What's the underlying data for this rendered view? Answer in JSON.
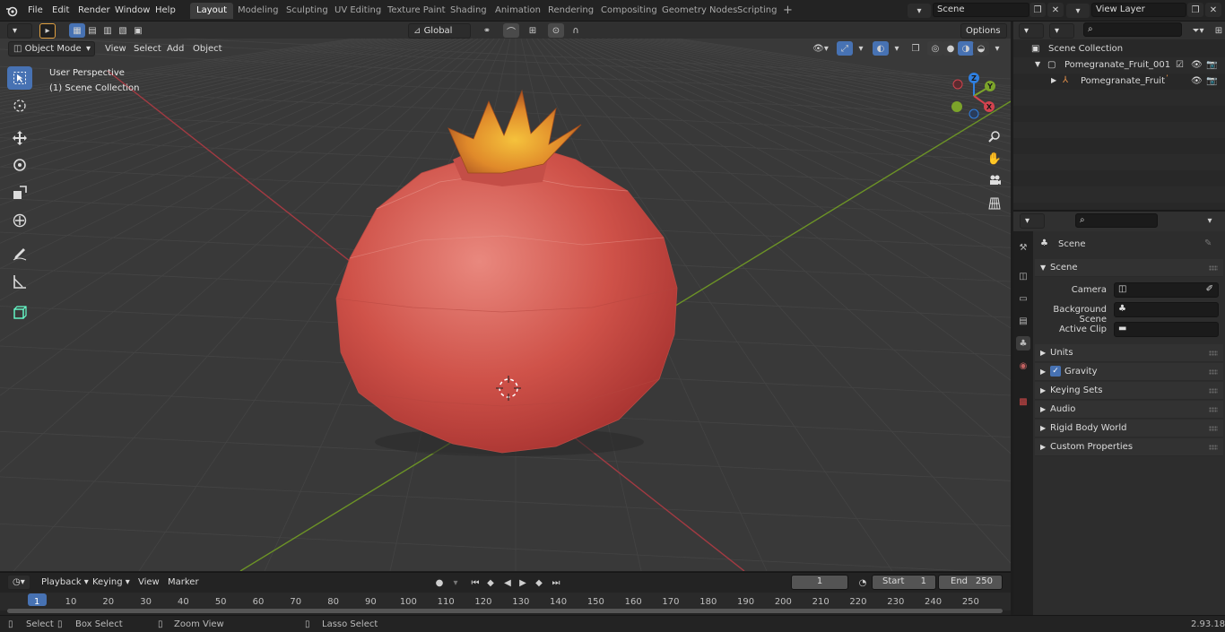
{
  "menu": [
    "File",
    "Edit",
    "Render",
    "Window",
    "Help"
  ],
  "workspaces": [
    "Layout",
    "Modeling",
    "Sculpting",
    "UV Editing",
    "Texture Paint",
    "Shading",
    "Animation",
    "Rendering",
    "Compositing",
    "Geometry Nodes",
    "Scripting"
  ],
  "active_workspace": "Layout",
  "scene_field": "Scene",
  "view_layer_field": "View Layer",
  "viewport": {
    "mode": "Object Mode",
    "header_menus": [
      "View",
      "Select",
      "Add",
      "Object"
    ],
    "transform_orientation": "Global",
    "options_label": "Options",
    "overlay_line1": "User Perspective",
    "overlay_line2": "(1) Scene Collection",
    "gizmo_axes": {
      "x": "X",
      "y": "Y",
      "z": "Z"
    }
  },
  "outliner": {
    "rows": [
      {
        "label": "Scene Collection"
      },
      {
        "label": "Pomegranate_Fruit_001"
      },
      {
        "label": "Pomegranate_Fruit"
      }
    ]
  },
  "properties": {
    "context_title": "Scene",
    "panel_title": "Scene",
    "fields": [
      {
        "label": "Camera"
      },
      {
        "label": "Background Scene"
      },
      {
        "label": "Active Clip"
      }
    ],
    "subpanels": [
      "Units",
      "Gravity",
      "Keying Sets",
      "Audio",
      "Rigid Body World",
      "Custom Properties"
    ]
  },
  "timeline": {
    "menus": [
      "Playback",
      "Keying",
      "View",
      "Marker"
    ],
    "current_frame": "1",
    "start_label": "Start",
    "start_value": "1",
    "end_label": "End",
    "end_value": "250",
    "ticks": [
      "1",
      "10",
      "20",
      "30",
      "40",
      "50",
      "60",
      "70",
      "80",
      "90",
      "100",
      "110",
      "120",
      "130",
      "140",
      "150",
      "160",
      "170",
      "180",
      "190",
      "200",
      "210",
      "220",
      "230",
      "240",
      "250"
    ]
  },
  "statusbar": {
    "items": [
      "Select",
      "Box Select",
      "Zoom View",
      "Lasso Select"
    ],
    "version": "2.93.18"
  },
  "colors": {
    "accent": "#4772b3",
    "x_axis": "#d2434e",
    "y_axis": "#7ca42a",
    "z_axis": "#2f7fe0",
    "fruit": "#c9504a"
  }
}
